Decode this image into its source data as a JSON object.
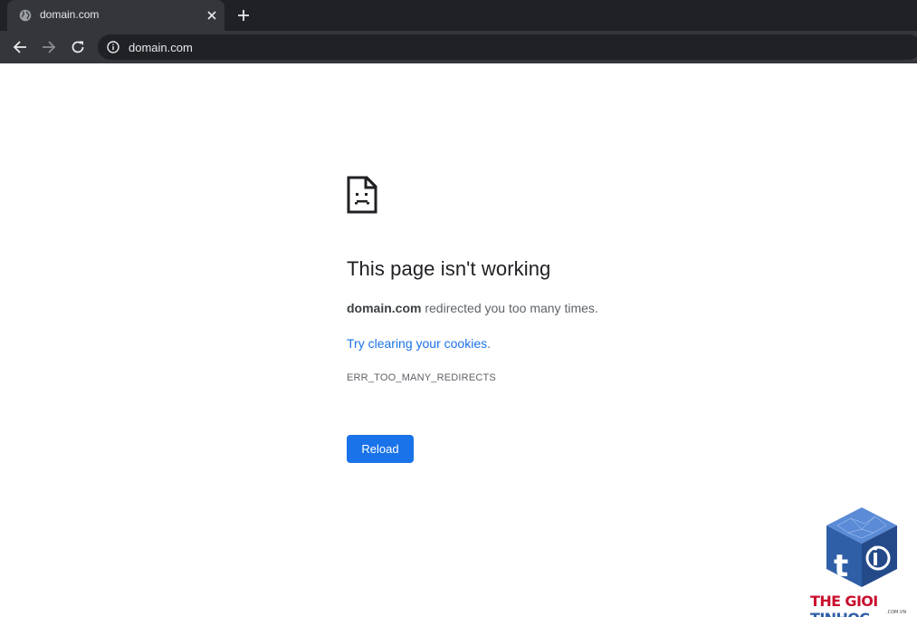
{
  "browser": {
    "tab": {
      "title": "domain.com",
      "favicon": "globe-icon",
      "close_icon": "close-icon"
    },
    "newtab_icon": "plus-icon",
    "nav": {
      "back_icon": "arrow-left-icon",
      "forward_icon": "arrow-right-icon",
      "reload_icon": "reload-icon"
    },
    "omnibox": {
      "info_icon": "info-icon",
      "url": "domain.com"
    }
  },
  "error": {
    "icon": "sad-page-icon",
    "title": "This page isn't working",
    "domain": "domain.com",
    "message": " redirected you too many times.",
    "suggestion_prefix": "Try ",
    "suggestion_link": "clearing your cookies",
    "suggestion_suffix": ".",
    "code": "ERR_TOO_MANY_REDIRECTS",
    "reload_label": "Reload"
  },
  "watermark": {
    "icon": "cube-logo-icon",
    "brand_part1": "THE GIOI",
    "brand_part2": "TINHOC",
    "domain_suffix": ".COM.VN"
  },
  "colors": {
    "tabstrip": "#202124",
    "toolbar": "#35363a",
    "accent": "#1a73e8",
    "brand_red": "#c8102e",
    "brand_blue": "#2f5fa7"
  }
}
